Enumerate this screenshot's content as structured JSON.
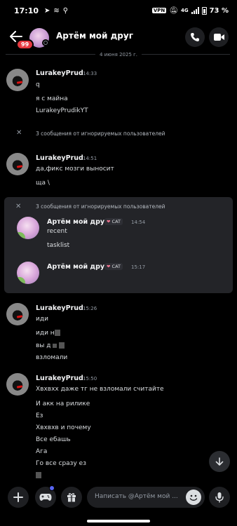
{
  "status_bar": {
    "time": "17:10",
    "vpn": "VPN",
    "network": "4G",
    "battery": "73 %"
  },
  "header": {
    "title": "Артём мой друг",
    "unread_badge": "99"
  },
  "date_divider": "4 июня 2025 г.",
  "messages": [
    {
      "author": "LurakeyPrud",
      "time": "14:33",
      "lines": [
        "q",
        "я с майна",
        "LurakeyPrudikYT"
      ]
    },
    {
      "author": "LurakeyPrud",
      "time": "14:51",
      "lines": [
        "да,фикс мозги выносит",
        "ща \\"
      ]
    },
    {
      "author": "Артём мой друг",
      "time": "14:54",
      "tag": "CAT",
      "lines": [
        "recent",
        "tasklist"
      ]
    },
    {
      "author": "Артём мой друг",
      "time": "15:17",
      "tag": "CAT",
      "lines": []
    },
    {
      "author": "LurakeyPrud",
      "time": "15:26",
      "lines": [
        "иди",
        "иди н",
        "вы д",
        "взломали"
      ]
    },
    {
      "author": "LurakeyPrud",
      "time": "15:50",
      "lines": [
        "Хвхвхх даже тг не взломали считайте",
        "И акк на рилике",
        "Ез",
        "Хвхвхв и почему",
        "Все ебашь",
        "Ага",
        "Го все сразу ез"
      ]
    }
  ],
  "ignored_notices": [
    "3 сообщения от игнорируемых пользователей",
    "3 сообщения от игнорируемых пользователей"
  ],
  "input": {
    "placeholder": "Написать @Артём мой ..."
  },
  "icons": {
    "back": "arrow-left-icon",
    "call": "phone-icon",
    "video": "video-camera-icon",
    "close": "close-icon",
    "scroll_down": "arrow-down-icon",
    "add": "plus-icon",
    "games": "gamepad-icon",
    "gift": "gift-icon",
    "emoji": "emoji-icon",
    "mic": "microphone-icon"
  },
  "colors": {
    "background": "#000000",
    "panel": "#232428",
    "badge": "#e5383f",
    "accent": "#5865f2"
  }
}
